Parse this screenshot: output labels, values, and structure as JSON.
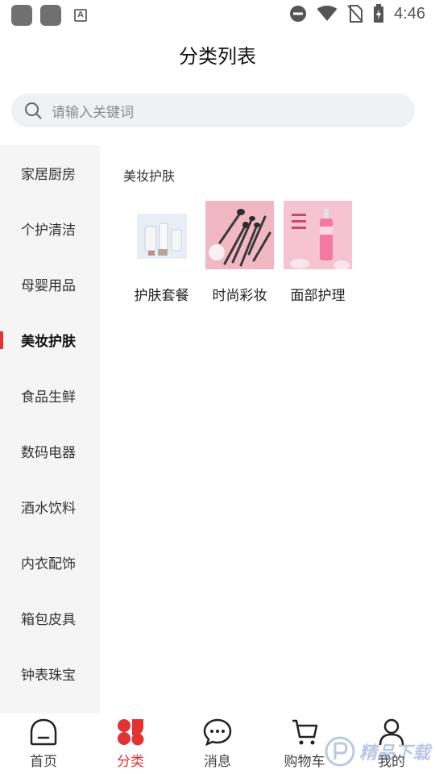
{
  "status_bar": {
    "time": "4:46"
  },
  "page_title": "分类列表",
  "search": {
    "placeholder": "请输入关键词"
  },
  "sidebar": {
    "items": [
      {
        "label": "家居厨房",
        "active": false
      },
      {
        "label": "个护清洁",
        "active": false
      },
      {
        "label": "母婴用品",
        "active": false
      },
      {
        "label": "美妆护肤",
        "active": true
      },
      {
        "label": "食品生鲜",
        "active": false
      },
      {
        "label": "数码电器",
        "active": false
      },
      {
        "label": "酒水饮料",
        "active": false
      },
      {
        "label": "内衣配饰",
        "active": false
      },
      {
        "label": "箱包皮具",
        "active": false
      },
      {
        "label": "钟表珠宝",
        "active": false
      }
    ]
  },
  "content": {
    "section_title": "美妆护肤",
    "subcategories": [
      {
        "label": "护肤套餐"
      },
      {
        "label": "时尚彩妆"
      },
      {
        "label": "面部护理"
      }
    ]
  },
  "bottom_nav": {
    "items": [
      {
        "label": "首页",
        "icon": "home-icon"
      },
      {
        "label": "分类",
        "icon": "category-icon",
        "active": true
      },
      {
        "label": "消息",
        "icon": "message-icon"
      },
      {
        "label": "购物车",
        "icon": "cart-icon"
      },
      {
        "label": "我的",
        "icon": "user-icon"
      }
    ]
  },
  "colors": {
    "accent": "#e23232",
    "sidebar_bg": "#f5f5f5",
    "search_bg": "#eff1f3"
  },
  "watermark": {
    "text": "精品下载"
  }
}
